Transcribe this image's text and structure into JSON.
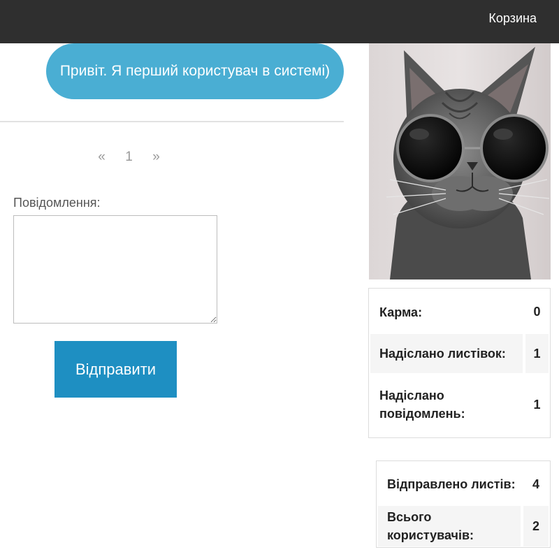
{
  "nav": {
    "cart_label": "Корзина"
  },
  "chat": {
    "message_text": "Привіт. Я перший користувач в системі)"
  },
  "pagination": {
    "prev": "«",
    "current": "1",
    "next": "»"
  },
  "form": {
    "message_label": "Повідомлення:",
    "message_value": "",
    "submit_label": "Відправити"
  },
  "profile_stats": [
    {
      "label": "Карма:",
      "value": "0"
    },
    {
      "label": "Надіслано листівок:",
      "value": "1"
    },
    {
      "label": "Надіслано повідомлень:",
      "value": "1"
    }
  ],
  "global_stats": [
    {
      "label": "Відправлено листів:",
      "value": "4"
    },
    {
      "label": "Всього користувачів:",
      "value": "2"
    }
  ],
  "colors": {
    "navbar": "#2f2f2f",
    "bubble": "#4aaed3",
    "button": "#1e8fc2"
  }
}
